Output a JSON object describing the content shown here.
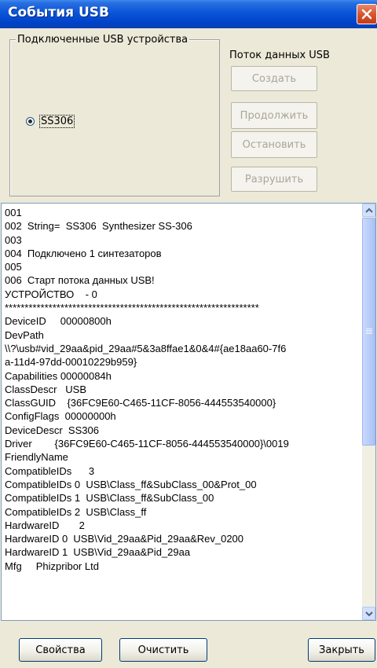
{
  "window": {
    "title": "События USB",
    "title_bar_color": "#0054e3",
    "close_button_color": "#d5532c"
  },
  "devices_group": {
    "label": "Подключенные USB устройства",
    "items": [
      {
        "label": "SS306",
        "selected": true
      }
    ]
  },
  "stream_panel": {
    "label": "Поток данных USB",
    "buttons": {
      "create": "Создать",
      "continue": "Продолжить",
      "stop": "Остановить",
      "destroy": "Разрушить"
    }
  },
  "log": {
    "lines": [
      "001",
      "002  String=  SS306  Synthesizer SS-306",
      "003",
      "004  Подключено 1 синтезаторов",
      "005",
      "006  Старт потока данных USB!",
      "УСТРОЙСТВО    - 0",
      "****************************************************************",
      "DeviceID     00000800h",
      "DevPath",
      "\\\\?\\usb#vid_29aa&pid_29aa#5&3a8ffae1&0&4#{ae18aa60-7f6",
      "a-11d4-97dd-00010229b959}",
      "Capabilities 00000084h",
      "ClassDescr   USB",
      "ClassGUID    {36FC9E60-C465-11CF-8056-444553540000}",
      "ConfigFlags  00000000h",
      "DeviceDescr  SS306",
      "Driver        {36FC9E60-C465-11CF-8056-444553540000}\\0019",
      "FriendlyName",
      "CompatibleIDs      3",
      "CompatibleIDs 0  USB\\Class_ff&SubClass_00&Prot_00",
      "CompatibleIDs 1  USB\\Class_ff&SubClass_00",
      "CompatibleIDs 2  USB\\Class_ff",
      "HardwareID       2",
      "HardwareID 0  USB\\Vid_29aa&Pid_29aa&Rev_0200",
      "HardwareID 1  USB\\Vid_29aa&Pid_29aa",
      "Mfg     Phizpribor Ltd"
    ]
  },
  "footer": {
    "properties": "Свойства",
    "clear": "Очистить",
    "close": "Закрыть"
  }
}
